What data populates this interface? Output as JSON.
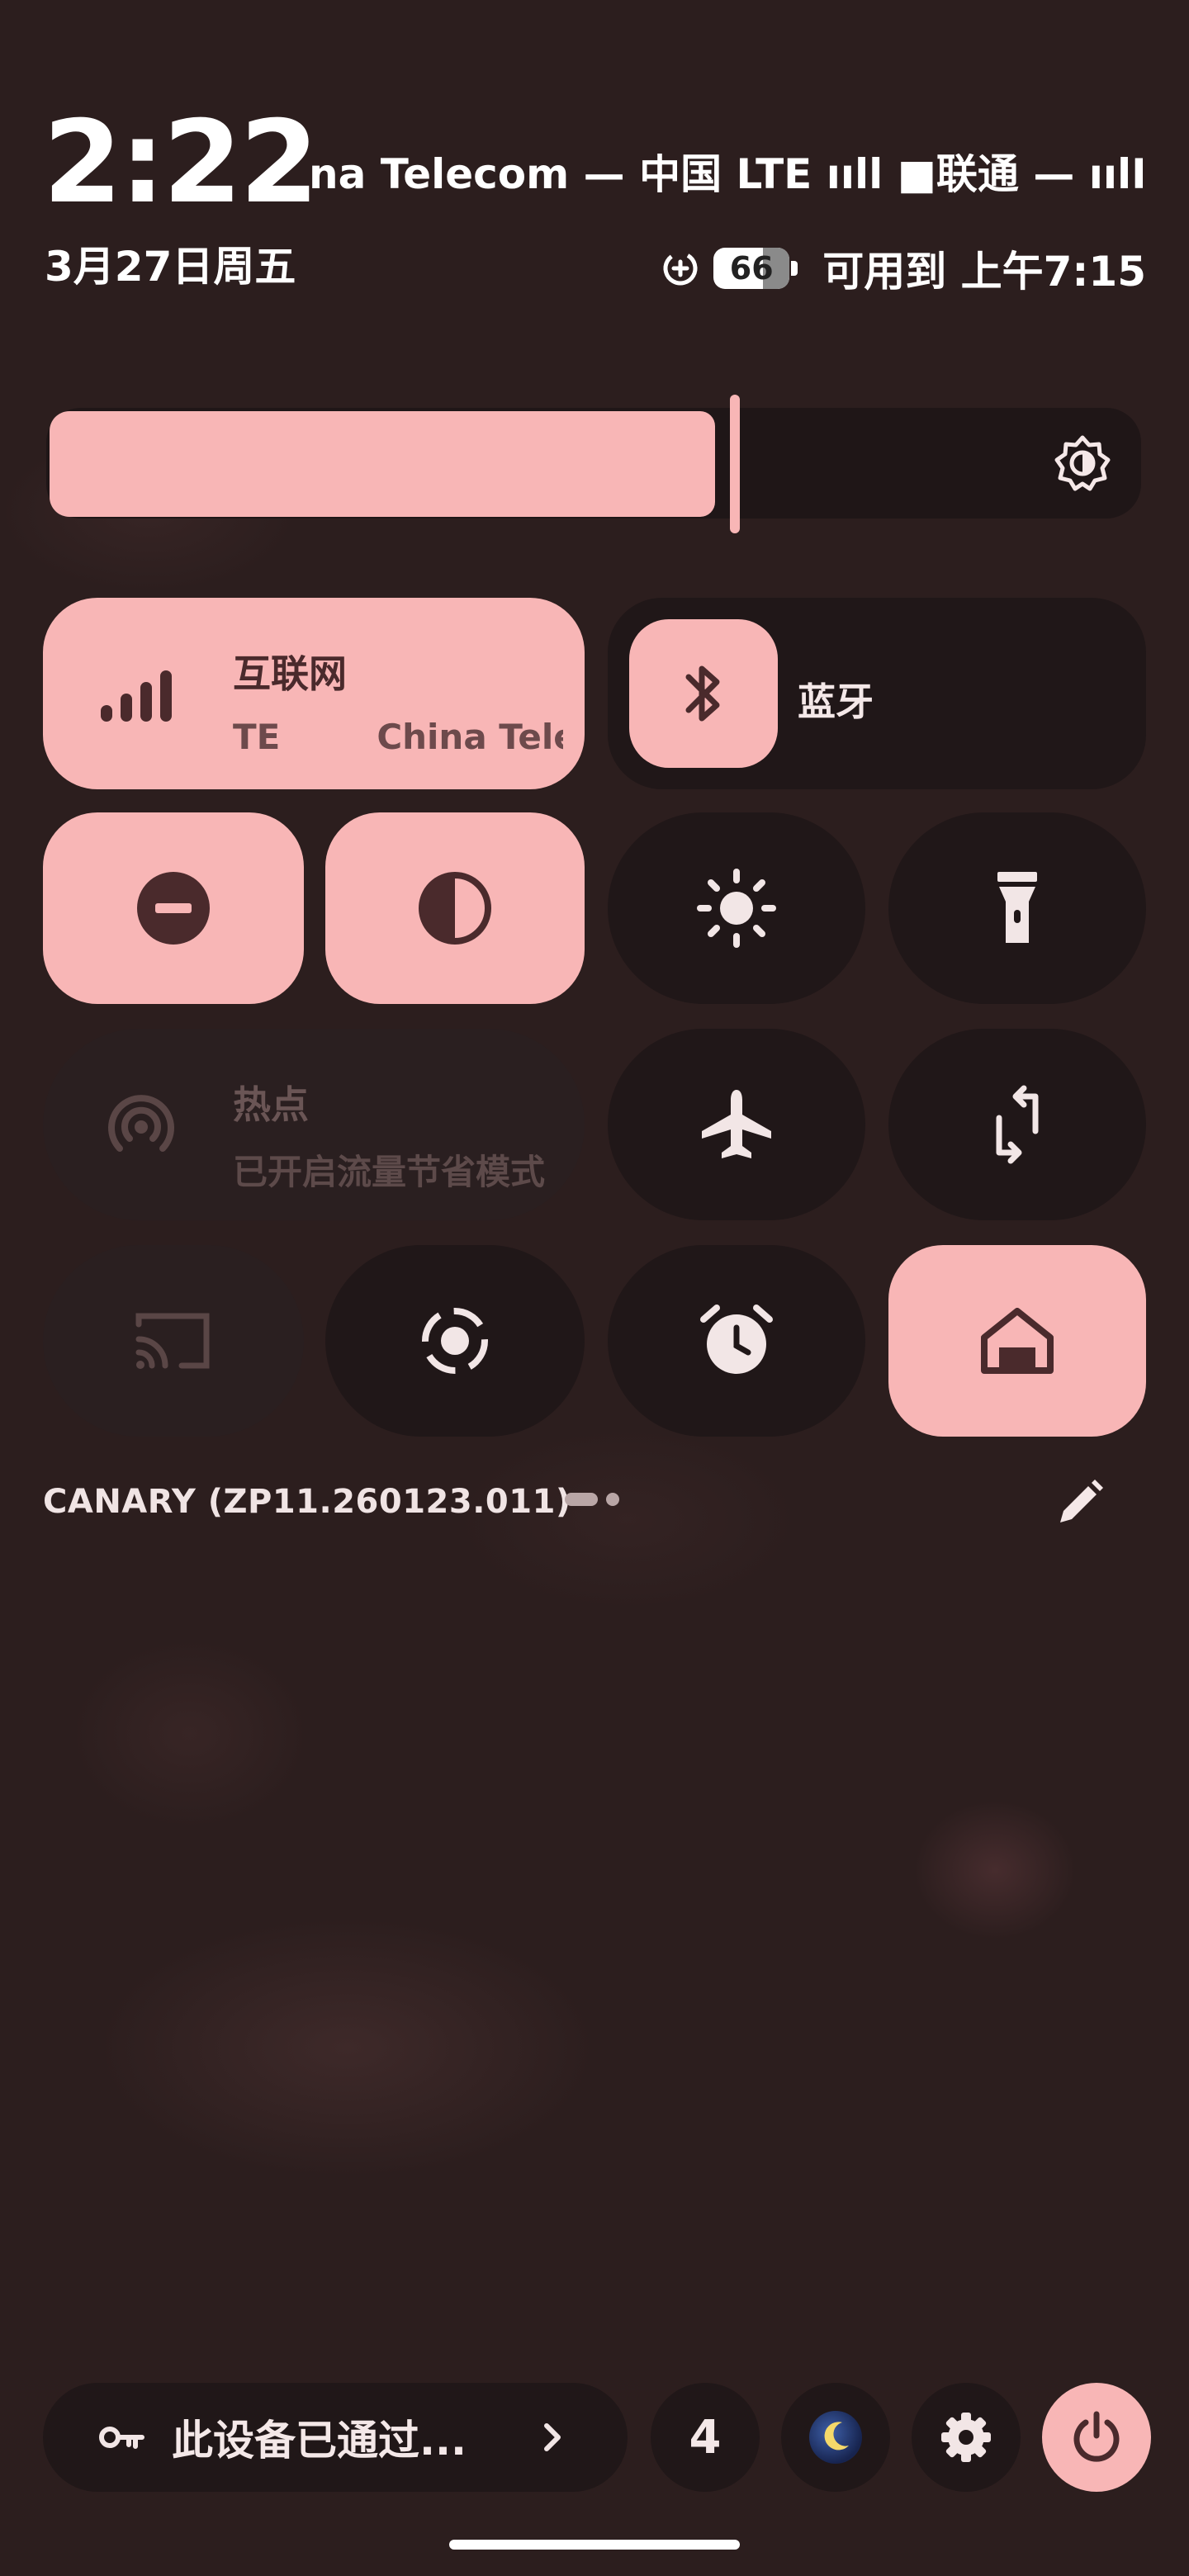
{
  "status": {
    "time": "2:22",
    "carrier": "na Telecom — 中国 LTE ııll ■联通 — ıılR",
    "date": "3月27日周五",
    "battery": "66",
    "alarm_until": "可用到 上午7:15"
  },
  "tiles": {
    "internet": {
      "title": "互联网",
      "subtitle": "TE        China Tele"
    },
    "bluetooth": {
      "title": "蓝牙"
    },
    "hotspot": {
      "title": "热点",
      "subtitle": "已开启流量节省模式"
    }
  },
  "build": "CANARY (ZP11.260123.011)",
  "footer": {
    "security_text": "此设备已通过...",
    "count": "4"
  },
  "colors": {
    "accent": "#f8b6b6",
    "background": "#2c1e1e",
    "tile_dark": "#201718",
    "icon_on_accent": "#4a2a2c"
  },
  "brightness_level": 0.6,
  "page_indicator": {
    "pages": 2,
    "current": 1
  }
}
